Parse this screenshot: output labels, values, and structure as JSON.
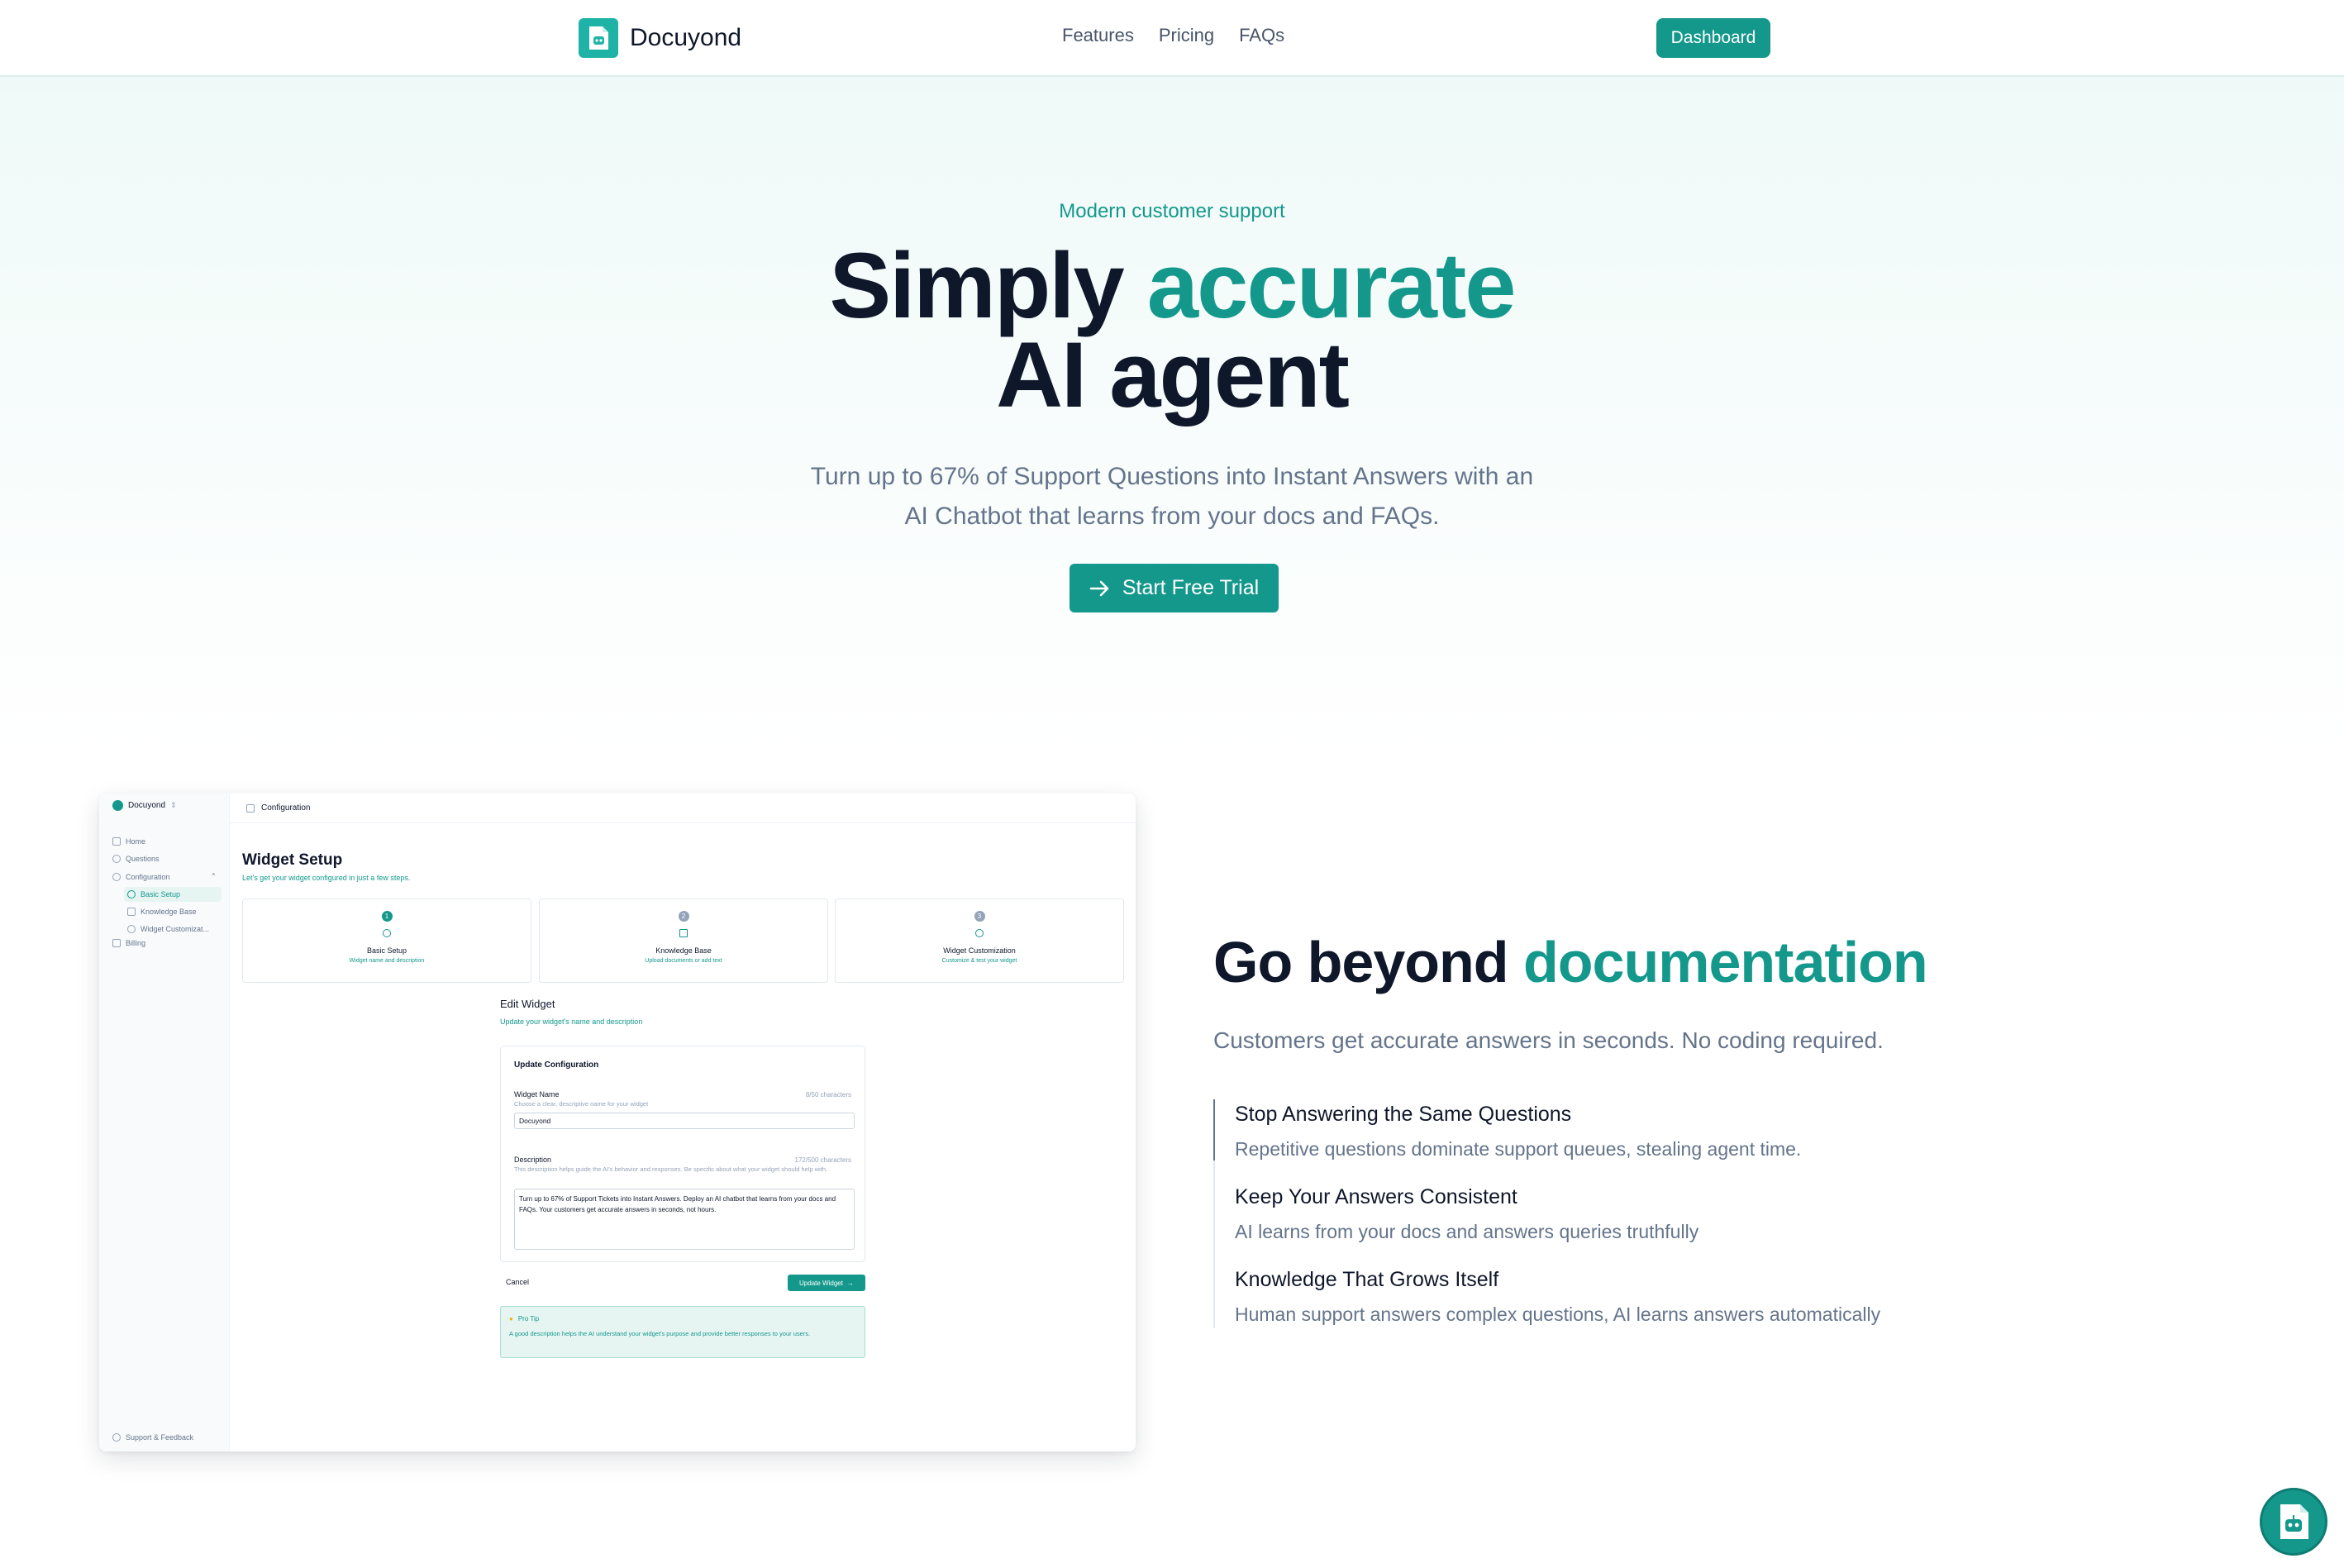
{
  "nav": {
    "brand": "Docuyond",
    "links": [
      "Features",
      "Pricing",
      "FAQs"
    ],
    "dashboard_label": "Dashboard"
  },
  "hero": {
    "eyebrow": "Modern customer support",
    "title_part1": "Simply ",
    "title_accent": "accurate",
    "title_line2": "AI agent",
    "subtitle": "Turn up to 67% of Support Questions into Instant Answers with an AI Chatbot that learns from your docs and FAQs.",
    "cta_label": "Start Free Trial"
  },
  "app": {
    "brand": "Docuyond",
    "sidebar": {
      "home": "Home",
      "questions": "Questions",
      "configuration": "Configuration",
      "basic_setup": "Basic Setup",
      "knowledge_base": "Knowledge Base",
      "widget_customization": "Widget Customizat...",
      "billing": "Billing",
      "support": "Support & Feedback"
    },
    "breadcrumb": "Configuration",
    "title": "Widget Setup",
    "subtitle": "Let's get your widget configured in just a few steps.",
    "steps": [
      {
        "num": "1",
        "name": "Basic Setup",
        "desc": "Widget name and description"
      },
      {
        "num": "2",
        "name": "Knowledge Base",
        "desc": "Upload documents or add text"
      },
      {
        "num": "3",
        "name": "Widget Customization",
        "desc": "Customize & test your widget"
      }
    ],
    "edit_title": "Edit Widget",
    "edit_subtitle": "Update your widget's name and description",
    "card_title": "Update Configuration",
    "name_label": "Widget Name",
    "name_count": "8/50 characters",
    "name_help": "Choose a clear, descriptive name for your widget",
    "name_value": "Docuyond",
    "desc_label": "Description",
    "desc_count": "172/500 characters",
    "desc_help": "This description helps guide the AI's behavior and responses. Be specific about what your widget should help with.",
    "desc_value": "Turn up to 67% of Support Tickets into Instant Answers. Deploy an AI chatbot that learns from your docs and FAQs. Your customers get accurate answers in seconds, not hours.",
    "cancel_label": "Cancel",
    "update_label": "Update Widget",
    "tip_title": "Pro Tip",
    "tip_text": "A good description helps the AI understand your widget's purpose and provide better responses to your users."
  },
  "feature": {
    "title_part1": "Go beyond ",
    "title_accent": "documentation",
    "subtitle": "Customers get accurate answers in seconds. No coding required.",
    "items": [
      {
        "title": "Stop Answering the Same Questions",
        "desc": "Repetitive questions dominate support queues, stealing agent time."
      },
      {
        "title": "Keep Your Answers Consistent",
        "desc": "AI learns from your docs and answers queries truthfully"
      },
      {
        "title": "Knowledge That Grows Itself",
        "desc": "Human support answers complex questions, AI learns answers automatically"
      }
    ]
  },
  "colors": {
    "accent": "#14988c",
    "heading": "#0f172a",
    "muted": "#64748b"
  },
  "icons": [
    "logo-icon",
    "arrow-right-icon",
    "chat-bot-icon"
  ]
}
